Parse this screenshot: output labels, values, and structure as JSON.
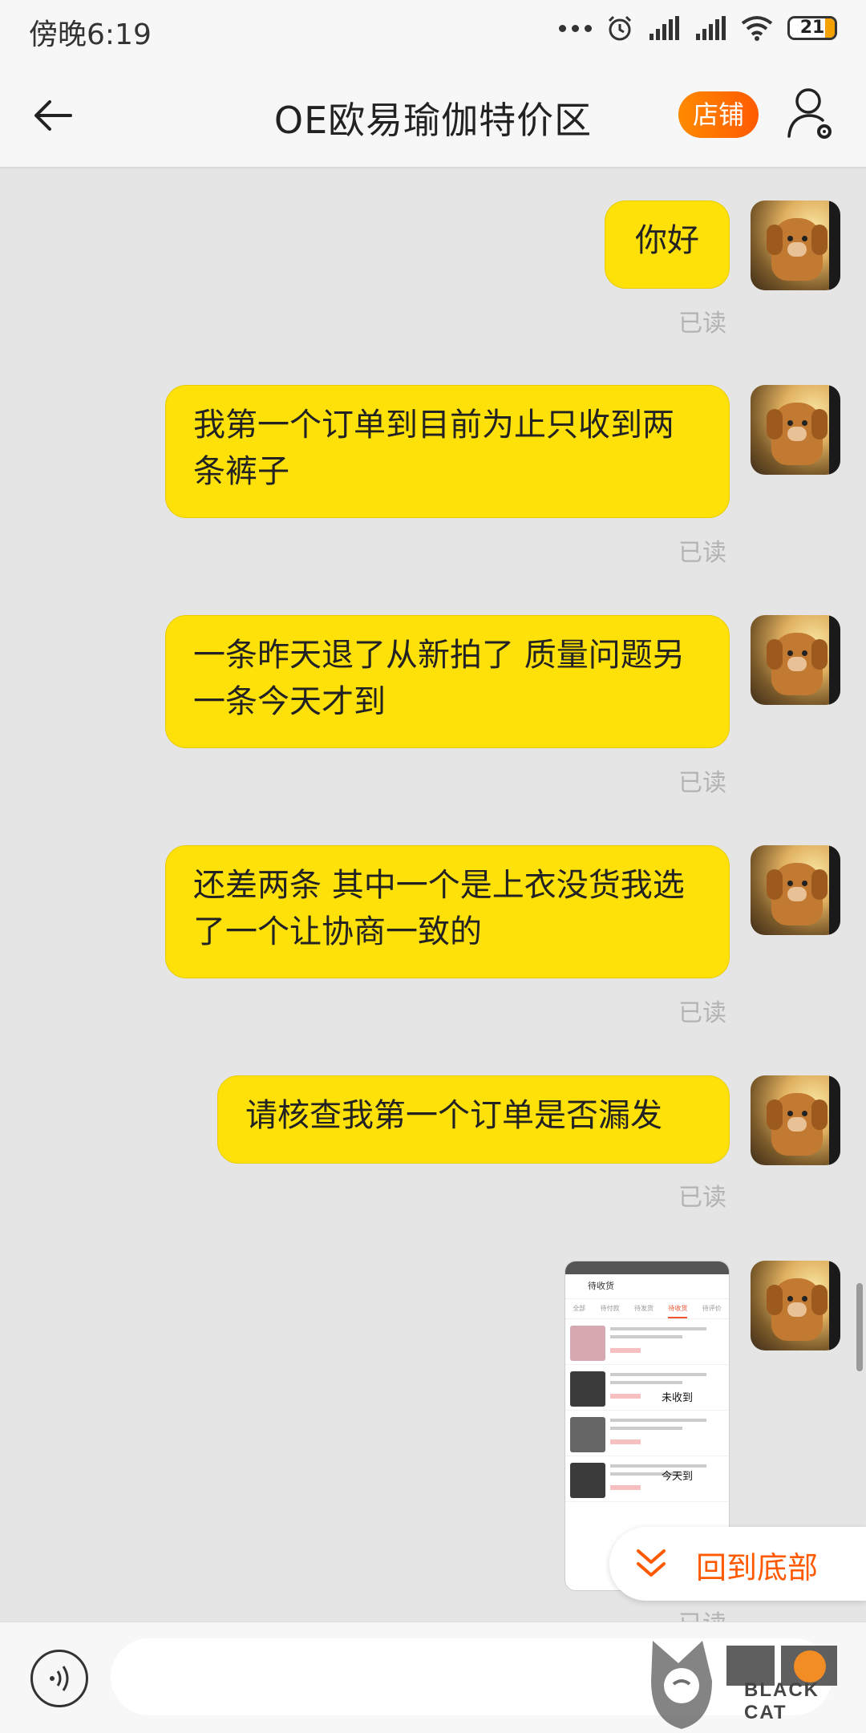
{
  "status_bar": {
    "time": "傍晚6:19",
    "battery": "21",
    "icons": [
      "more-dots-icon",
      "alarm-icon",
      "signal-icon",
      "signal-icon",
      "wifi-icon",
      "battery-icon"
    ]
  },
  "header": {
    "title": "OE欧易瑜伽特价区",
    "shop_button": "店铺"
  },
  "messages": [
    {
      "text": "你好",
      "status": "已读"
    },
    {
      "text": "我第一个订单到目前为止只收到两条裤子",
      "status": "已读"
    },
    {
      "text": "一条昨天退了从新拍了 质量问题另一条今天才到",
      "status": "已读"
    },
    {
      "text": "还差两条 其中一个是上衣没货我选了一个让协商一致的",
      "status": "已读"
    },
    {
      "text": "请核查我第一个订单是否漏发",
      "status": "已读"
    }
  ],
  "image_message": {
    "header": "待收货",
    "tabs": [
      "全部",
      "待付款",
      "待发货",
      "待收货",
      "待评价"
    ],
    "notes": [
      "未收到",
      "今天到"
    ],
    "status": "已读"
  },
  "jump_to_bottom": "回到底部",
  "input": {
    "placeholder": ""
  },
  "watermark": {
    "text": "BLACK CAT"
  },
  "colors": {
    "bubble": "#ffe10a",
    "accent": "#ff5a00",
    "background": "#e5e5e5"
  }
}
